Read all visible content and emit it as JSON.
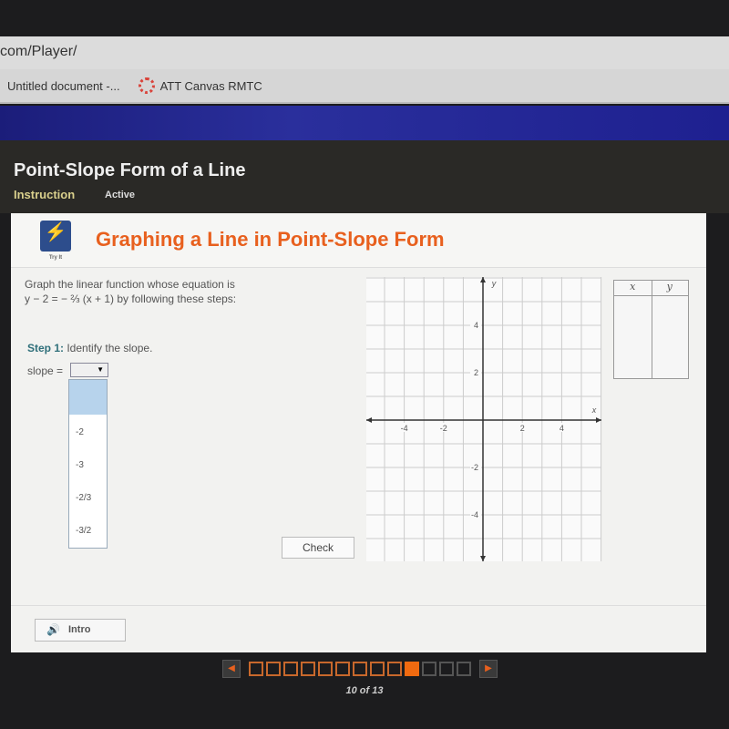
{
  "browser": {
    "url": "com/Player/",
    "bookmarks": [
      {
        "label": "Untitled document -..."
      },
      {
        "label": "ATT Canvas RMTC",
        "icon": "canvas-icon"
      }
    ]
  },
  "course": {
    "title": "Point-Slope Form of a Line",
    "tabs": [
      "Instruction",
      "Active"
    ]
  },
  "card": {
    "logo_text": "Try It",
    "heading": "Graphing a Line in Point-Slope Form",
    "prompt_line1": "Graph the linear function whose equation is",
    "prompt_line2": "y − 2 = − ⅔ (x + 1) by following these steps:",
    "step_label": "Step 1:",
    "step_text": " Identify the slope.",
    "slope_label": "slope =",
    "slope_value": "",
    "options": [
      "",
      "-2",
      "-3",
      "-2/3",
      "-3/2"
    ],
    "check_label": "Check",
    "intro_label": "Intro",
    "table_headers": [
      "x",
      "y"
    ]
  },
  "graph": {
    "x_label": "x",
    "y_label": "y",
    "x_ticks": [
      "-4",
      "-2",
      "2",
      "4"
    ],
    "y_ticks": [
      "4",
      "2",
      "-2",
      "-4"
    ],
    "xlim": [
      -6,
      6
    ],
    "ylim": [
      -6,
      6
    ]
  },
  "progress": {
    "current": 10,
    "total": 13,
    "text": "10 of 13"
  },
  "colors": {
    "accent": "#e8601e",
    "step": "#2f6f7a",
    "highlight": "#b7d3ec"
  }
}
